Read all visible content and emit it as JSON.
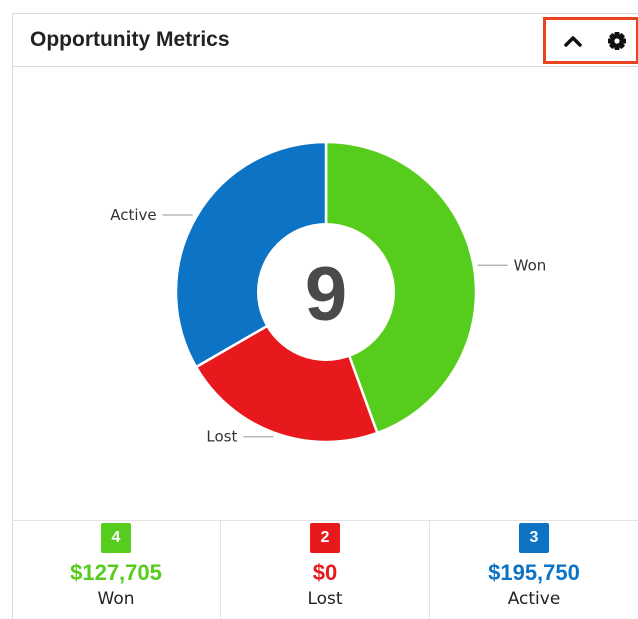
{
  "header": {
    "title": "Opportunity Metrics",
    "collapse_icon": "chevron-up-icon",
    "settings_icon": "gear-icon"
  },
  "chart_data": {
    "type": "pie",
    "categories": [
      "Won",
      "Lost",
      "Active"
    ],
    "values": [
      4,
      2,
      3
    ],
    "colors": [
      "#56cc1c",
      "#e8191c",
      "#0c73c5"
    ],
    "center_label": "9",
    "legend": "slice labels"
  },
  "stats": [
    {
      "count": "4",
      "amount": "$127,705",
      "label": "Won",
      "color": "#56cc1c"
    },
    {
      "count": "2",
      "amount": "$0",
      "label": "Lost",
      "color": "#e8191c"
    },
    {
      "count": "3",
      "amount": "$195,750",
      "label": "Active",
      "color": "#0c73c5"
    }
  ]
}
